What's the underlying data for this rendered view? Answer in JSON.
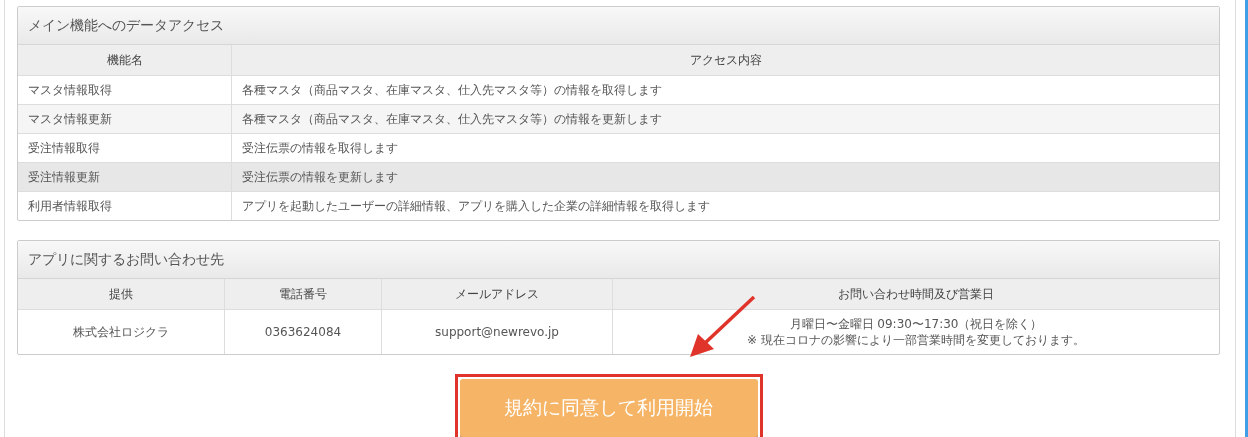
{
  "access_panel": {
    "title": "メイン機能へのデータアクセス",
    "columns": [
      "機能名",
      "アクセス内容"
    ],
    "rows": [
      {
        "cells": [
          "マスタ情報取得",
          "各種マスタ（商品マスタ、在庫マスタ、仕入先マスタ等）の情報を取得します"
        ],
        "highlighted": false
      },
      {
        "cells": [
          "マスタ情報更新",
          "各種マスタ（商品マスタ、在庫マスタ、仕入先マスタ等）の情報を更新します"
        ],
        "highlighted": false
      },
      {
        "cells": [
          "受注情報取得",
          "受注伝票の情報を取得します"
        ],
        "highlighted": false
      },
      {
        "cells": [
          "受注情報更新",
          "受注伝票の情報を更新します"
        ],
        "highlighted": true
      },
      {
        "cells": [
          "利用者情報取得",
          "アプリを起動したユーザーの詳細情報、アプリを購入した企業の詳細情報を取得します"
        ],
        "highlighted": false
      }
    ]
  },
  "contact_panel": {
    "title": "アプリに関するお問い合わせ先",
    "columns": [
      "提供",
      "電話番号",
      "メールアドレス",
      "お問い合わせ時間及び営業日"
    ],
    "rows": [
      {
        "cells": [
          [
            "株式会社ロジクラ"
          ],
          [
            "0363624084"
          ],
          [
            "support@newrevo.jp"
          ],
          [
            "月曜日〜金曜日 09:30〜17:30（祝日を除く）",
            "※ 現在コロナの影響により一部営業時間を変更しております。"
          ]
        ]
      }
    ]
  },
  "agree_button": {
    "label": "規約に同意して利用開始"
  }
}
